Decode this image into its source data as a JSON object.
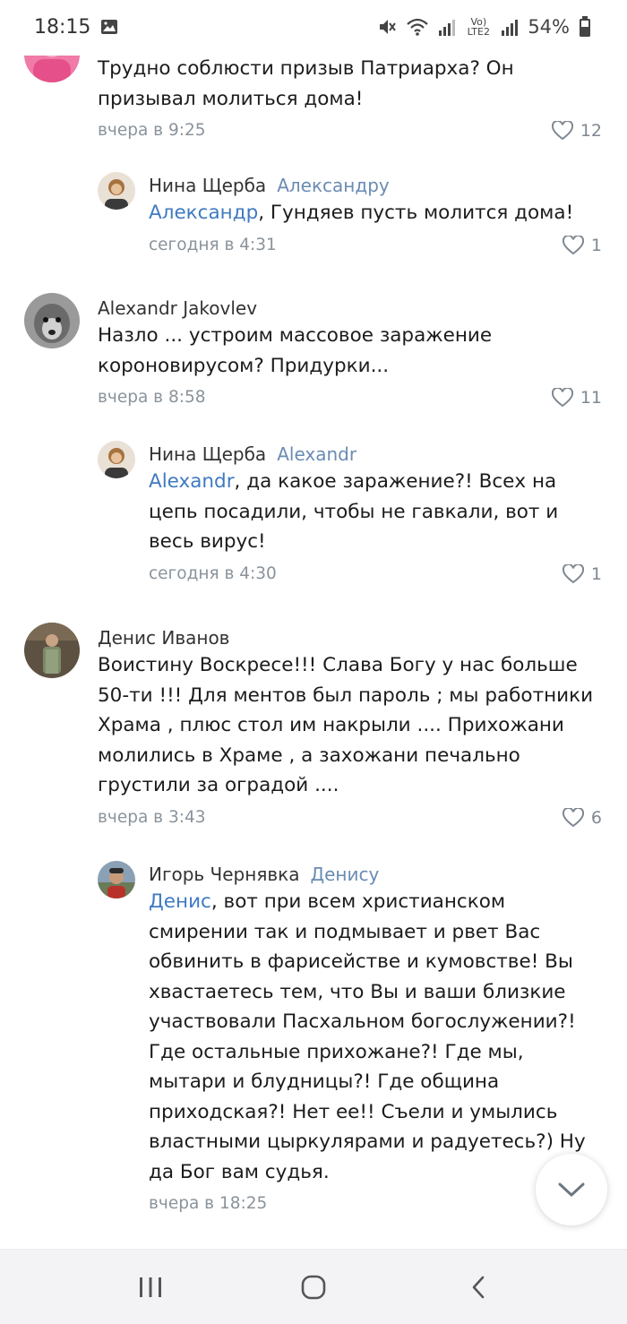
{
  "status_bar": {
    "time": "18:15",
    "battery": "54%",
    "network": "Vo) LTE2",
    "icons": [
      "image-icon",
      "mute-icon",
      "wifi-icon",
      "signal-icon",
      "signal-icon",
      "battery-icon"
    ]
  },
  "comments": [
    {
      "kind": "top",
      "author": "",
      "text": "Трудно соблюсти призыв Патриарха? Он призывал молиться дома!",
      "time": "вчера в 9:25",
      "likes": "12"
    },
    {
      "kind": "reply",
      "author": "Нина Щерба",
      "reply_to": "Александру",
      "mention": "Александр",
      "text": ", Гундяев пусть молится дома!",
      "time": "сегодня в 4:31",
      "likes": "1"
    },
    {
      "kind": "top",
      "author": "Alexandr Jakovlev",
      "text": "Назло ... устроим массовое заражение короновирусом? Придурки...",
      "time": "вчера в 8:58",
      "likes": "11"
    },
    {
      "kind": "reply",
      "author": "Нина Щерба",
      "reply_to": "Alexandr",
      "mention": "Alexandr",
      "text": ", да какое заражение?! Всех на цепь посадили, чтобы не гавкали, вот и весь вирус!",
      "time": "сегодня в 4:30",
      "likes": "1"
    },
    {
      "kind": "top",
      "author": "Денис Иванов",
      "text": "Воистину Воскресе!!! Слава Богу у нас больше 50-ти !!! Для ментов был пароль ; мы работники Храма , плюс стол им накрыли .... Прихожани молились в Храме , а захожани печально грустили за оградой ....",
      "time": "вчера в 3:43",
      "likes": "6"
    },
    {
      "kind": "reply",
      "author": "Игорь Чернявка",
      "reply_to": "Денису",
      "mention": "Денис",
      "text": ", вот при всем христианском смирении так и подмывает и рвет Вас обвинить в фарисействе и кумовстве!  Вы хвастаетесь тем, что Вы и ваши близкие участвовали Пасхальном богослужении?! Где остальные прихожане?! Где мы, мытари и блудницы?! Где община приходская?! Нет ее!! Съели и умылись властными цыркулярами и радуетесь?) Ну да Бог вам судья.",
      "time": "вчера в 18:25",
      "likes": ""
    }
  ],
  "colors": {
    "mention": "#3f7ac2",
    "reply_to": "#6a8bb3",
    "meta": "#8a939b",
    "navbar_bg": "#f3f3f5"
  },
  "icons": {
    "like": "heart-icon",
    "scroll_down": "chevron-down-icon",
    "nav": [
      "recent-apps-icon",
      "home-icon",
      "back-icon"
    ]
  }
}
